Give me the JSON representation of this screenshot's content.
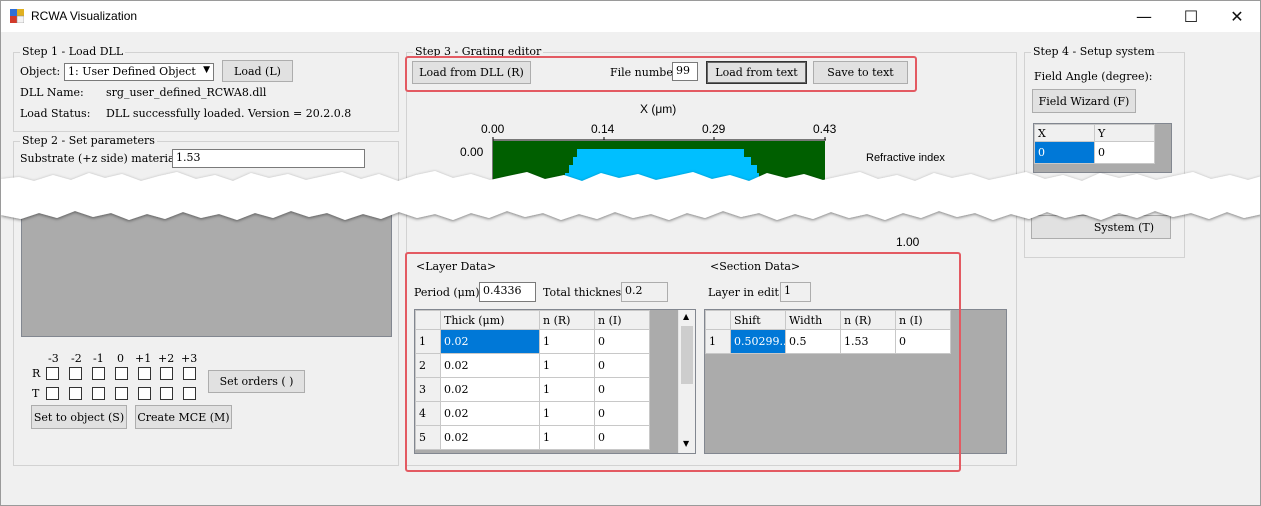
{
  "window": {
    "title": "RCWA Visualization",
    "minimize": "—",
    "maximize": "☐",
    "close": "✕"
  },
  "step1": {
    "title": "Step 1 - Load DLL",
    "object_label": "Object:",
    "object_value": "1: User Defined Object",
    "load_button": "Load (L)",
    "dll_name_label": "DLL Name:",
    "dll_name_value": "srg_user_defined_RCWA8.dll",
    "load_status_label": "Load Status:",
    "load_status_value": "DLL successfully loaded. Version = 20.2.0.8"
  },
  "step2": {
    "title": "Step 2 - Set parameters",
    "substrate_label": "Substrate (+z side) material:",
    "substrate_value": "1.53",
    "orders": [
      "-3",
      "-2",
      "-1",
      "0",
      "+1",
      "+2",
      "+3"
    ],
    "row_r": "R",
    "row_t": "T",
    "set_orders_button": "Set orders ( )",
    "set_to_object_button": "Set to object (S)",
    "create_mce_button": "Create MCE (M)"
  },
  "step3": {
    "title": "Step 3 - Grating editor",
    "load_from_dll_button": "Load from DLL (R)",
    "file_number_label": "File number:",
    "file_number_value": "99",
    "load_from_text_button": "Load from text",
    "save_to_text_button": "Save to text",
    "plot": {
      "x_axis_label": "X (μm)",
      "x_ticks": [
        "0.00",
        "0.14",
        "0.29",
        "0.43"
      ],
      "y_tick_top": "0.00",
      "legend_title": "Refractive index",
      "colorbar_bottom": "1.00"
    },
    "layer_data": {
      "title": "<Layer Data>",
      "period_label": "Period (μm):",
      "period_value": "0.4336",
      "total_thickness_label": "Total thickness:",
      "total_thickness_value": "0.2",
      "columns": [
        "Thick (μm)",
        "n (R)",
        "n (I)"
      ],
      "rows": [
        {
          "idx": "1",
          "thick": "0.02",
          "nr": "1",
          "ni": "0"
        },
        {
          "idx": "2",
          "thick": "0.02",
          "nr": "1",
          "ni": "0"
        },
        {
          "idx": "3",
          "thick": "0.02",
          "nr": "1",
          "ni": "0"
        },
        {
          "idx": "4",
          "thick": "0.02",
          "nr": "1",
          "ni": "0"
        },
        {
          "idx": "5",
          "thick": "0.02",
          "nr": "1",
          "ni": "0"
        }
      ]
    },
    "section_data": {
      "title": "<Section Data>",
      "layer_in_edit_label": "Layer in edit:",
      "layer_in_edit_value": "1",
      "columns": [
        "Shift",
        "Width",
        "n (R)",
        "n (I)"
      ],
      "rows": [
        {
          "idx": "1",
          "shift": "0.50299...",
          "width": "0.5",
          "nr": "1.53",
          "ni": "0"
        }
      ]
    }
  },
  "step4": {
    "title": "Step 4 - Setup system",
    "field_angle_label": "Field Angle (degree):",
    "field_wizard_button": "Field Wizard (F)",
    "columns": [
      "X",
      "Y"
    ],
    "row": {
      "x": "0",
      "y": "0"
    },
    "system_button": "System (T)"
  },
  "colors": {
    "dark_green": "#005f00",
    "cyan": "#00bfff",
    "highlight": "#e35a62",
    "selection": "#0078d7"
  }
}
